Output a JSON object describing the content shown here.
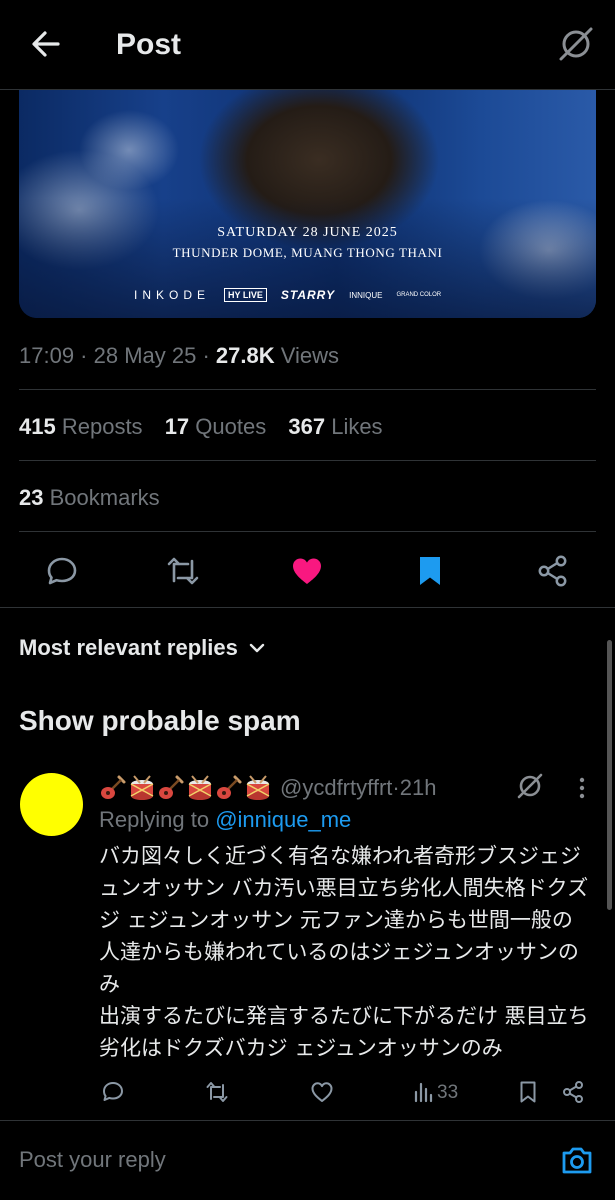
{
  "header": {
    "title": "Post",
    "back_icon": "arrow-left-icon",
    "grok_icon": "grok-icon"
  },
  "media": {
    "date_line": "SATURDAY  28 JUNE 2025",
    "venue_line": "THUNDER DOME, MUANG THONG THANI",
    "logos": [
      "INKODE",
      "HY LIVE",
      "STARRY",
      "INNIQUE",
      "GRAND COLOR"
    ]
  },
  "meta": {
    "time": "17:09",
    "date": "28 May 25",
    "views_count": "27.8K",
    "views_label": "Views",
    "sep": " · "
  },
  "stats": [
    {
      "count": "415",
      "label": "Reposts"
    },
    {
      "count": "17",
      "label": "Quotes"
    },
    {
      "count": "367",
      "label": "Likes"
    }
  ],
  "bookmarks": {
    "count": "23",
    "label": "Bookmarks"
  },
  "actions": {
    "icons": [
      "reply-icon",
      "repost-icon",
      "like-icon",
      "bookmark-icon",
      "share-icon"
    ],
    "like_color": "#f91880",
    "bookmark_color": "#1d9bf0"
  },
  "sort": {
    "label": "Most relevant replies"
  },
  "spam_header": "Show probable spam",
  "reply": {
    "avatar_color": "#ffff00",
    "name_emojis": [
      "guitar",
      "drum",
      "guitar",
      "drum",
      "guitar",
      "drum"
    ],
    "handle": "@ycdfrtyffrt",
    "time": "21h",
    "sep": " · ",
    "replying_to_label": "Replying to ",
    "replying_to_handle": "@innique_me",
    "text": "バカ図々しく近づく有名な嫌われ者奇形ブスジェジュンオッサン バカ汚い悪目立ち劣化人間失格ドクズジ ェジュンオッサン 元ファン達からも世間一般の人達からも嫌われているのはジェジュンオッサンのみ\n出演するたびに発言するたびに下がるだけ 悪目立ち劣化はドクズバカジ ェジュンオッサンのみ",
    "views_count": "33"
  },
  "composer": {
    "placeholder": "Post your reply",
    "camera_icon": "camera-icon"
  }
}
